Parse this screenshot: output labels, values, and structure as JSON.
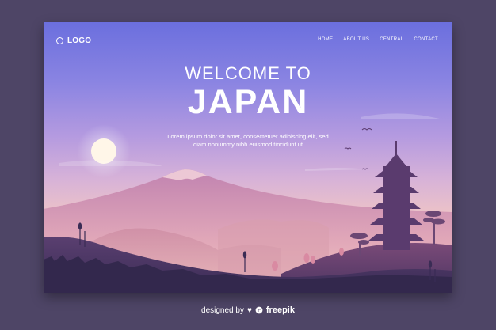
{
  "brand": {
    "logo": "LOGO"
  },
  "nav": {
    "items": [
      "HOME",
      "ABOUT US",
      "CENTRAL",
      "CONTACT"
    ]
  },
  "hero": {
    "title": "WELCOME TO",
    "subtitle": "JAPAN",
    "text": "Lorem ipsum dolor sit amet, consectetuer adipiscing elit, sed diam nonummy nibh euismod tincidunt ut"
  },
  "footer": {
    "prefix": "designed by",
    "brand": "freepik"
  },
  "icons": {
    "logo": "circle-logo-icon",
    "footer_brand": "freepik-logo-icon",
    "heart": "heart-icon"
  },
  "colors": {
    "page_background": "#4e4566",
    "sky_top": "#6b6fde",
    "sky_bottom": "#f3cdbb",
    "foreground_hill": "#3d2f5a",
    "text": "#ffffff"
  }
}
